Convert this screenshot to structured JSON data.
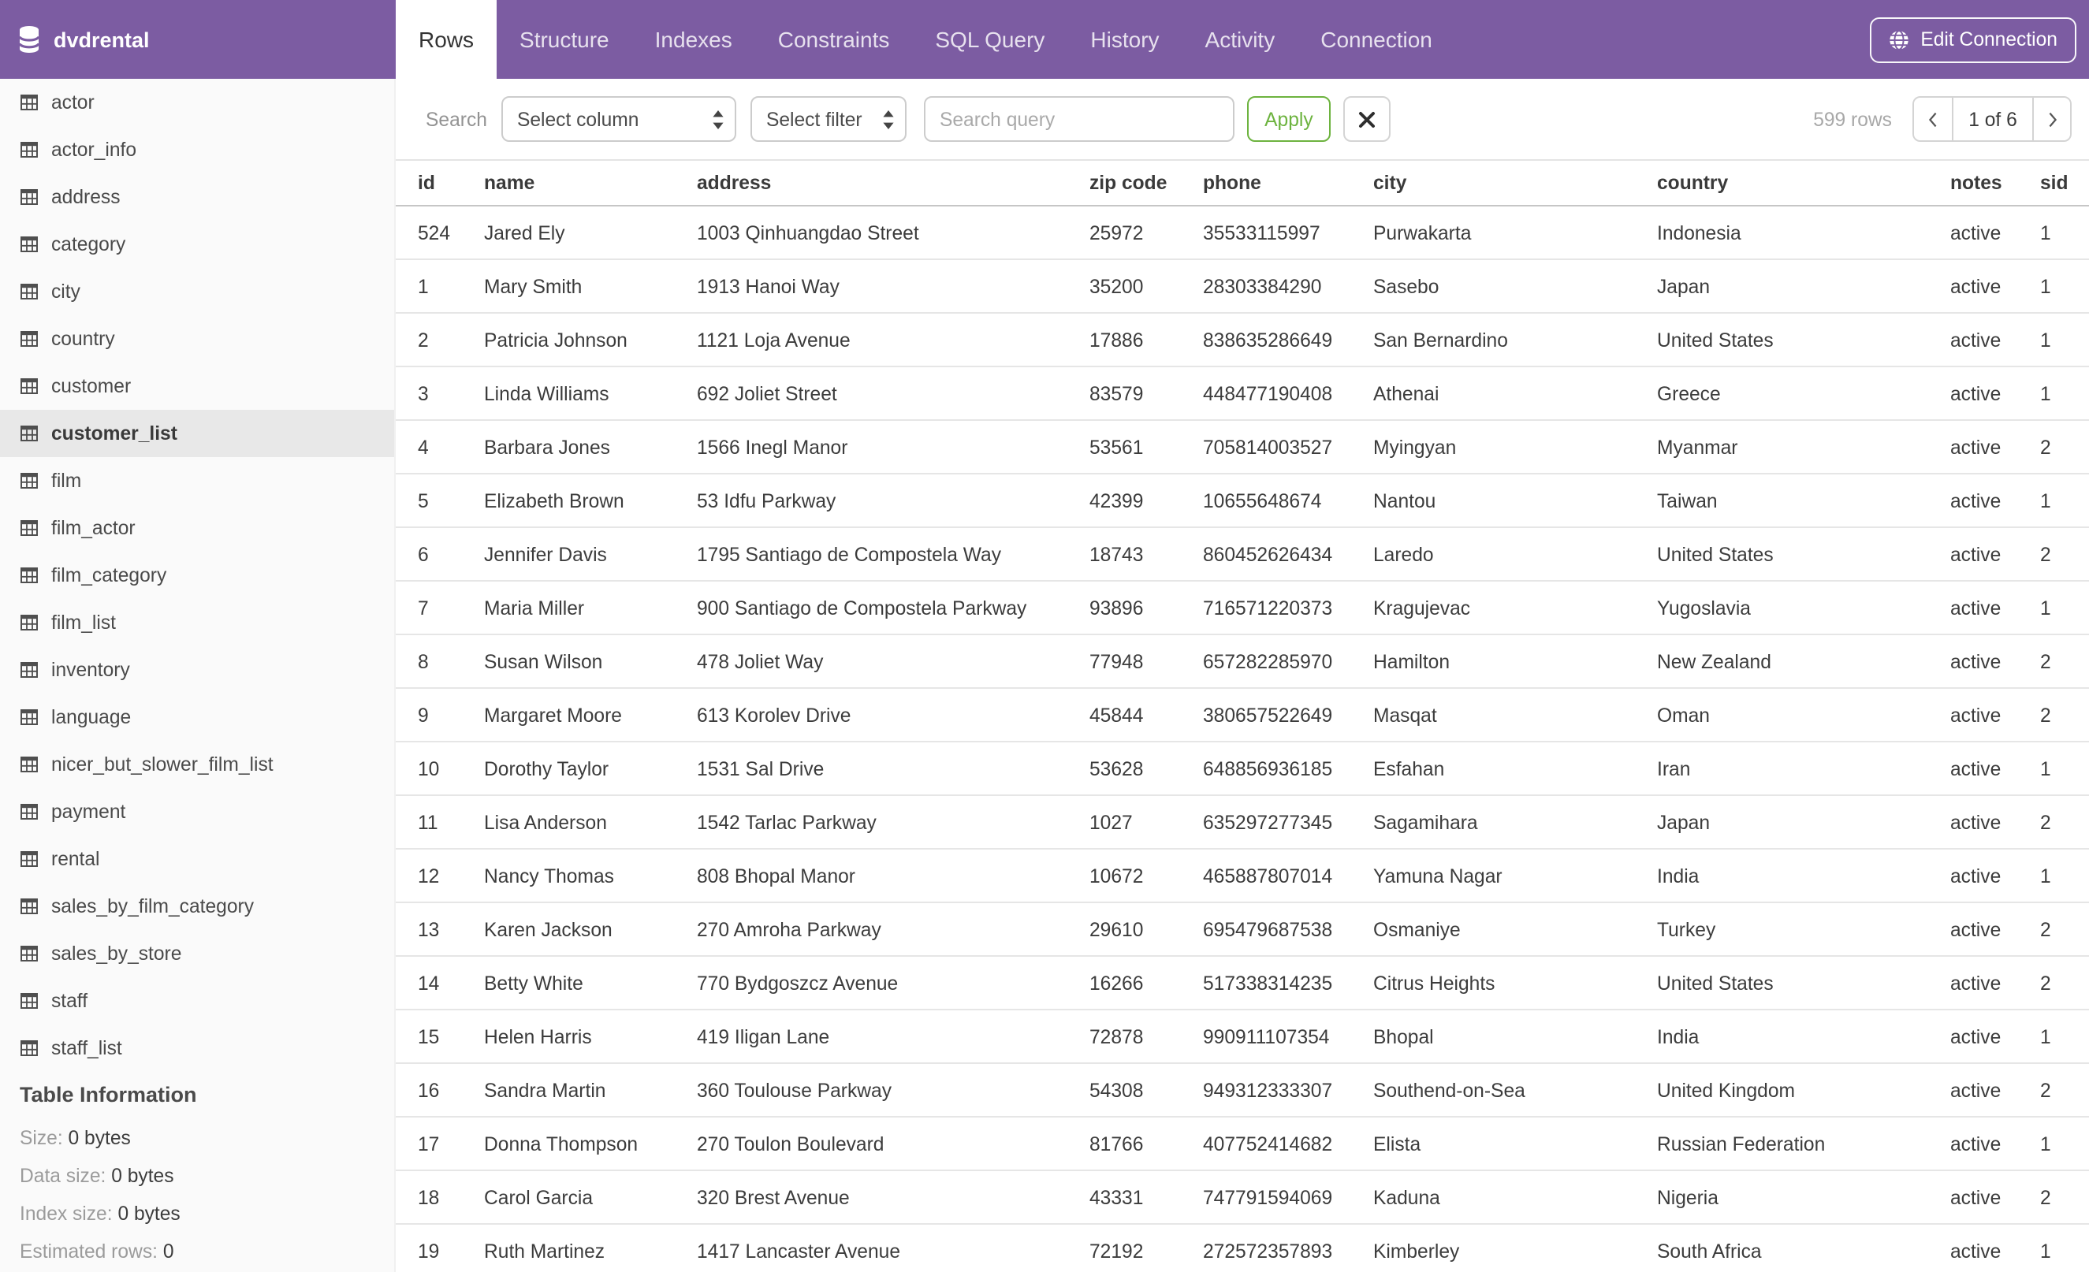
{
  "colors": {
    "header_purple": "#7C5CA2",
    "apply_green": "#6DB33F",
    "sidebar_bg": "#FAFAFA",
    "selected_item_bg": "#E8E8E8"
  },
  "header": {
    "brand": "dvdrental",
    "tabs": [
      {
        "label": "Rows",
        "active": true
      },
      {
        "label": "Structure",
        "active": false
      },
      {
        "label": "Indexes",
        "active": false
      },
      {
        "label": "Constraints",
        "active": false
      },
      {
        "label": "SQL Query",
        "active": false
      },
      {
        "label": "History",
        "active": false
      },
      {
        "label": "Activity",
        "active": false
      },
      {
        "label": "Connection",
        "active": false
      }
    ],
    "edit_connection": "Edit Connection"
  },
  "icons": {
    "brand": "database-icon",
    "edit_connection": "globe-icon",
    "sidebar_item": "table-icon",
    "select": "up-down-arrows-icon",
    "clear": "x-icon",
    "prev": "chevron-left-icon",
    "next": "chevron-right-icon"
  },
  "sidebar": {
    "tables": [
      "actor",
      "actor_info",
      "address",
      "category",
      "city",
      "country",
      "customer",
      "customer_list",
      "film",
      "film_actor",
      "film_category",
      "film_list",
      "inventory",
      "language",
      "nicer_but_slower_film_list",
      "payment",
      "rental",
      "sales_by_film_category",
      "sales_by_store",
      "staff",
      "staff_list"
    ],
    "selected": "customer_list",
    "table_information": {
      "title": "Table Information",
      "items": [
        {
          "label": "Size:",
          "value": "0 bytes"
        },
        {
          "label": "Data size:",
          "value": "0 bytes"
        },
        {
          "label": "Index size:",
          "value": "0 bytes"
        },
        {
          "label": "Estimated rows:",
          "value": "0"
        }
      ]
    }
  },
  "toolbar": {
    "search_label": "Search",
    "column_select": "Select column",
    "filter_select": "Select filter",
    "query_placeholder": "Search query",
    "apply": "Apply",
    "row_count": "599 rows",
    "page": {
      "label": "1 of 6"
    }
  },
  "grid": {
    "columns": [
      "id",
      "name",
      "address",
      "zip code",
      "phone",
      "city",
      "country",
      "notes",
      "sid"
    ],
    "rows": [
      [
        "524",
        "Jared Ely",
        "1003 Qinhuangdao Street",
        "25972",
        "35533115997",
        "Purwakarta",
        "Indonesia",
        "active",
        "1"
      ],
      [
        "1",
        "Mary Smith",
        "1913 Hanoi Way",
        "35200",
        "28303384290",
        "Sasebo",
        "Japan",
        "active",
        "1"
      ],
      [
        "2",
        "Patricia Johnson",
        "1121 Loja Avenue",
        "17886",
        "838635286649",
        "San Bernardino",
        "United States",
        "active",
        "1"
      ],
      [
        "3",
        "Linda Williams",
        "692 Joliet Street",
        "83579",
        "448477190408",
        "Athenai",
        "Greece",
        "active",
        "1"
      ],
      [
        "4",
        "Barbara Jones",
        "1566 Inegl Manor",
        "53561",
        "705814003527",
        "Myingyan",
        "Myanmar",
        "active",
        "2"
      ],
      [
        "5",
        "Elizabeth Brown",
        "53 Idfu Parkway",
        "42399",
        "10655648674",
        "Nantou",
        "Taiwan",
        "active",
        "1"
      ],
      [
        "6",
        "Jennifer Davis",
        "1795 Santiago de Compostela Way",
        "18743",
        "860452626434",
        "Laredo",
        "United States",
        "active",
        "2"
      ],
      [
        "7",
        "Maria Miller",
        "900 Santiago de Compostela Parkway",
        "93896",
        "716571220373",
        "Kragujevac",
        "Yugoslavia",
        "active",
        "1"
      ],
      [
        "8",
        "Susan Wilson",
        "478 Joliet Way",
        "77948",
        "657282285970",
        "Hamilton",
        "New Zealand",
        "active",
        "2"
      ],
      [
        "9",
        "Margaret Moore",
        "613 Korolev Drive",
        "45844",
        "380657522649",
        "Masqat",
        "Oman",
        "active",
        "2"
      ],
      [
        "10",
        "Dorothy Taylor",
        "1531 Sal Drive",
        "53628",
        "648856936185",
        "Esfahan",
        "Iran",
        "active",
        "1"
      ],
      [
        "11",
        "Lisa Anderson",
        "1542 Tarlac Parkway",
        "1027",
        "635297277345",
        "Sagamihara",
        "Japan",
        "active",
        "2"
      ],
      [
        "12",
        "Nancy Thomas",
        "808 Bhopal Manor",
        "10672",
        "465887807014",
        "Yamuna Nagar",
        "India",
        "active",
        "1"
      ],
      [
        "13",
        "Karen Jackson",
        "270 Amroha Parkway",
        "29610",
        "695479687538",
        "Osmaniye",
        "Turkey",
        "active",
        "2"
      ],
      [
        "14",
        "Betty White",
        "770 Bydgoszcz Avenue",
        "16266",
        "517338314235",
        "Citrus Heights",
        "United States",
        "active",
        "2"
      ],
      [
        "15",
        "Helen Harris",
        "419 Iligan Lane",
        "72878",
        "990911107354",
        "Bhopal",
        "India",
        "active",
        "1"
      ],
      [
        "16",
        "Sandra Martin",
        "360 Toulouse Parkway",
        "54308",
        "949312333307",
        "Southend-on-Sea",
        "United Kingdom",
        "active",
        "2"
      ],
      [
        "17",
        "Donna Thompson",
        "270 Toulon Boulevard",
        "81766",
        "407752414682",
        "Elista",
        "Russian Federation",
        "active",
        "1"
      ],
      [
        "18",
        "Carol Garcia",
        "320 Brest Avenue",
        "43331",
        "747791594069",
        "Kaduna",
        "Nigeria",
        "active",
        "2"
      ],
      [
        "19",
        "Ruth Martinez",
        "1417 Lancaster Avenue",
        "72192",
        "272572357893",
        "Kimberley",
        "South Africa",
        "active",
        "1"
      ]
    ]
  }
}
